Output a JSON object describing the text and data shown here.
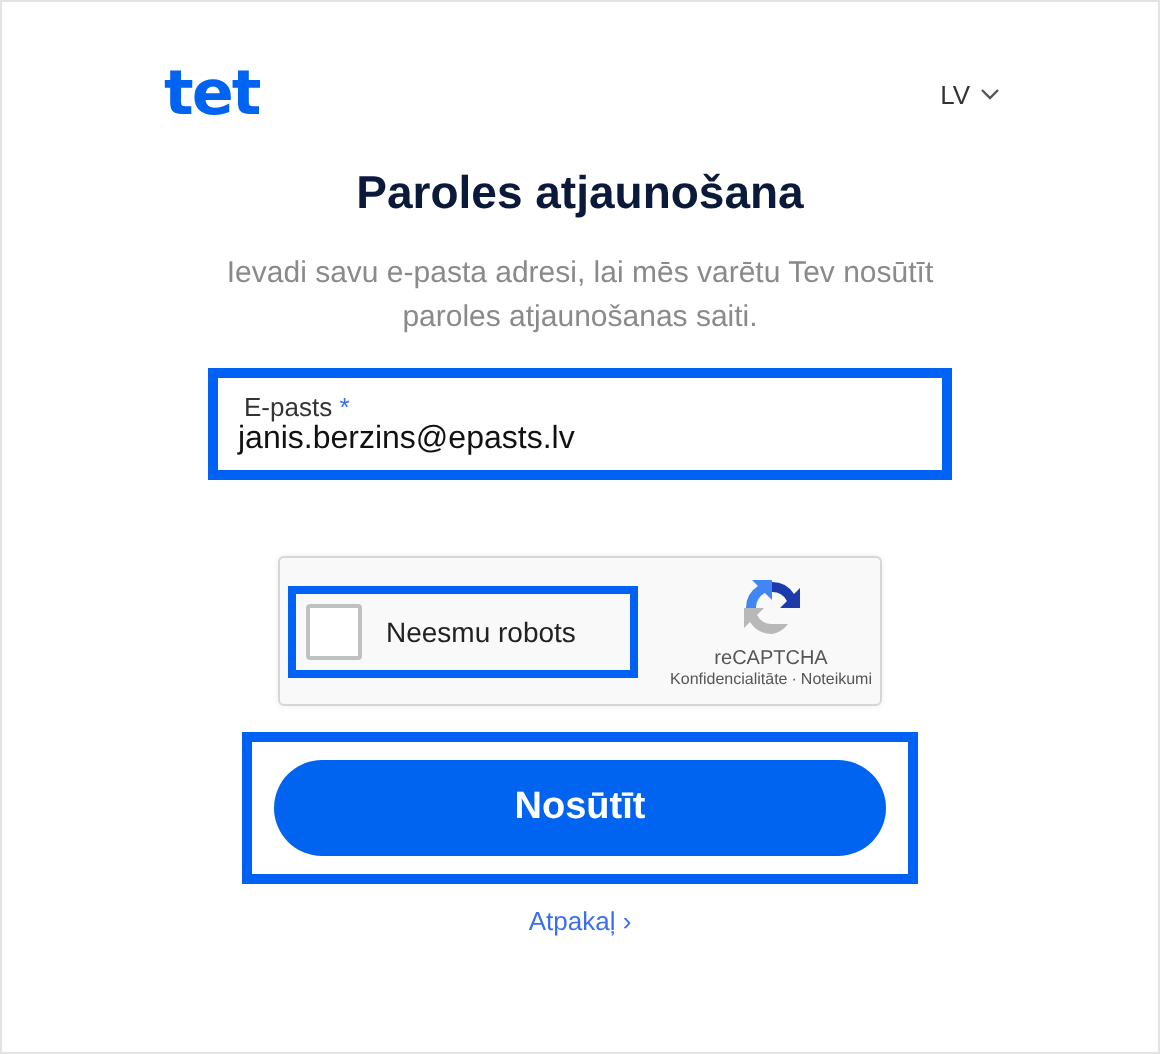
{
  "logo": "tet",
  "language": {
    "label": "LV"
  },
  "title": "Paroles atjaunošana",
  "description": "Ievadi savu e-pasta adresi, lai mēs varētu Tev nosūtīt paroles atjaunošanas saiti.",
  "email_field": {
    "label": "E-pasts",
    "required_mark": "*",
    "value": "janis.berzins@epasts.lv",
    "highlighted": true
  },
  "captcha": {
    "label": "Neesmu robots",
    "checked": false,
    "highlighted": true,
    "brand": "reCAPTCHA",
    "privacy_link": "Konfidencialitāte",
    "separator": "·",
    "terms_link": "Noteikumi"
  },
  "submit_button": {
    "label": "Nosūtīt",
    "highlighted": true
  },
  "back_link": {
    "label": "Atpakaļ",
    "arrow": "›"
  }
}
